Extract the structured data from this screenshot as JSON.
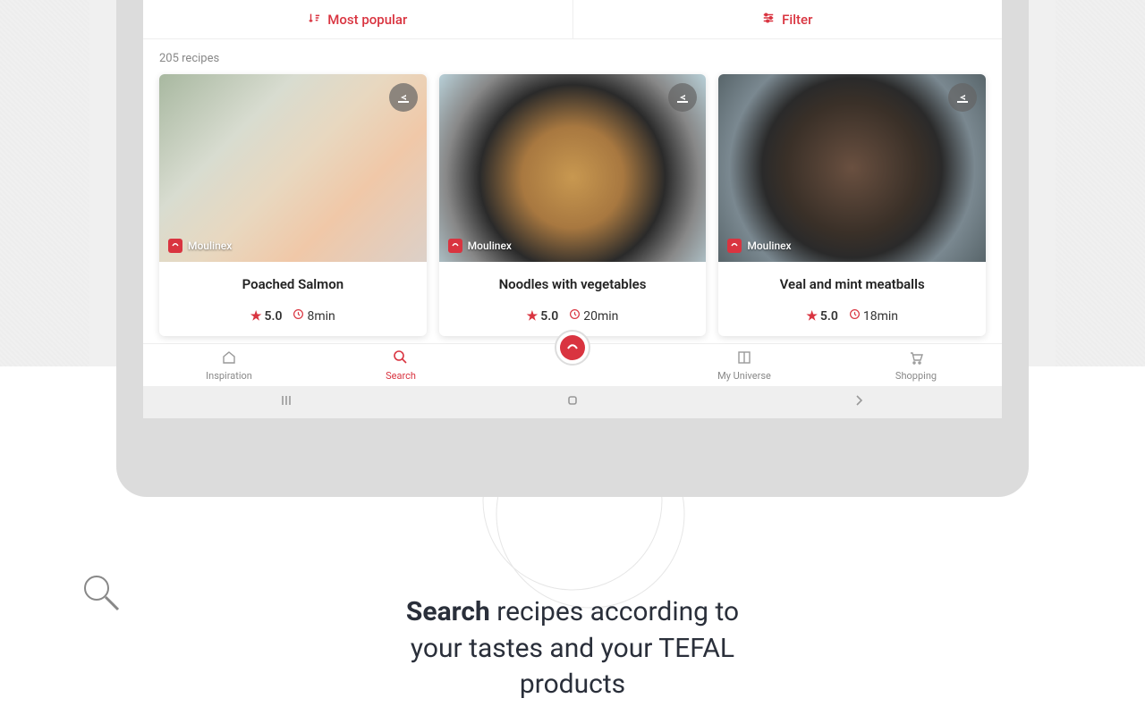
{
  "topbar": {
    "sort_label": "Most popular",
    "filter_label": "Filter"
  },
  "results": {
    "count_label": "205 recipes"
  },
  "cards": [
    {
      "brand": "Moulinex",
      "title": "Poached Salmon",
      "rating": "5.0",
      "duration": "8min"
    },
    {
      "brand": "Moulinex",
      "title": "Noodles with vegetables",
      "rating": "5.0",
      "duration": "20min"
    },
    {
      "brand": "Moulinex",
      "title": "Veal and mint meatballs",
      "rating": "5.0",
      "duration": "18min"
    }
  ],
  "nav": {
    "inspiration": "Inspiration",
    "search": "Search",
    "myuniverse": "My Universe",
    "shopping": "Shopping"
  },
  "promo": {
    "bold": "Search",
    "line1_rest": " recipes according to",
    "line2": "your tastes and your TEFAL",
    "line3": "products"
  }
}
